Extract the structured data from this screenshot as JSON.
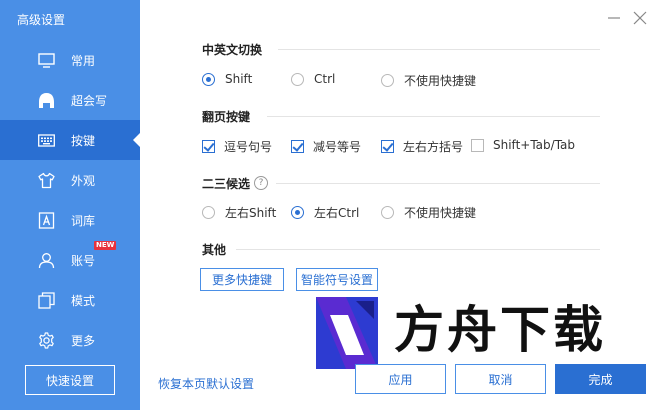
{
  "window": {
    "title": "高级设置"
  },
  "sidebar": {
    "items": [
      {
        "label": "常用",
        "icon": "monitor-icon"
      },
      {
        "label": "超会写",
        "icon": "pen-icon"
      },
      {
        "label": "按键",
        "icon": "keyboard-icon",
        "active": true
      },
      {
        "label": "外观",
        "icon": "shirt-icon"
      },
      {
        "label": "词库",
        "icon": "dictionary-icon"
      },
      {
        "label": "账号",
        "icon": "user-icon",
        "badge": "NEW"
      },
      {
        "label": "模式",
        "icon": "mode-icon"
      },
      {
        "label": "更多",
        "icon": "gear-icon"
      }
    ],
    "quick_settings_label": "快速设置"
  },
  "sections": {
    "switch": {
      "title": "中英文切换",
      "options": [
        {
          "label": "Shift",
          "checked": true
        },
        {
          "label": "Ctrl",
          "checked": false
        },
        {
          "label": "不使用快捷键",
          "checked": false
        }
      ]
    },
    "paging": {
      "title": "翻页按键",
      "options": [
        {
          "label": "逗号句号",
          "checked": true
        },
        {
          "label": "减号等号",
          "checked": true
        },
        {
          "label": "左右方括号",
          "checked": true
        },
        {
          "label": "Shift+Tab/Tab",
          "checked": false
        }
      ]
    },
    "candidate": {
      "title": "二三候选",
      "help": "?",
      "options": [
        {
          "label": "左右Shift",
          "checked": false
        },
        {
          "label": "左右Ctrl",
          "checked": true
        },
        {
          "label": "不使用快捷键",
          "checked": false
        }
      ]
    },
    "other": {
      "title": "其他",
      "buttons": [
        "更多快捷键",
        "智能符号设置"
      ]
    }
  },
  "footer": {
    "restore_label": "恢复本页默认设置",
    "apply_label": "应用",
    "cancel_label": "取消",
    "done_label": "完成"
  },
  "watermark": {
    "text": "方舟下载"
  },
  "colors": {
    "sidebar": "#4a8fe6",
    "active": "#2a6fd2",
    "accent": "#2a6fd2"
  }
}
